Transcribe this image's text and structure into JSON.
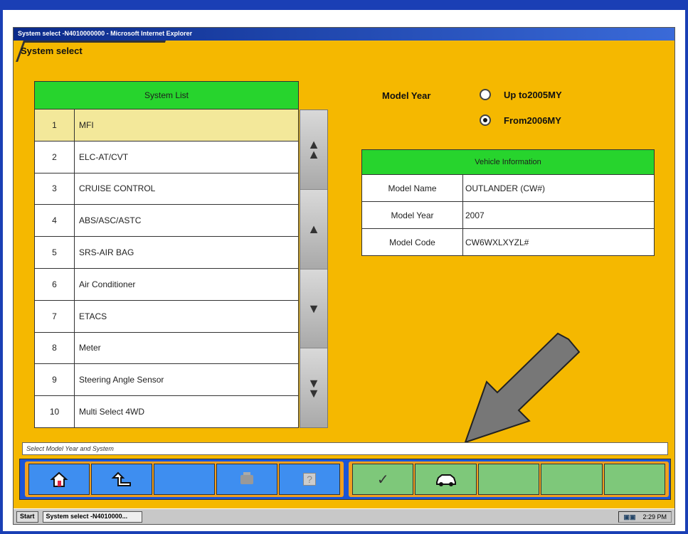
{
  "window": {
    "title": "System select -N4010000000 - Microsoft Internet Explorer",
    "header": "System select"
  },
  "system_list": {
    "heading": "System List",
    "rows": [
      {
        "num": "1",
        "name": "MFI"
      },
      {
        "num": "2",
        "name": "ELC-AT/CVT"
      },
      {
        "num": "3",
        "name": "CRUISE CONTROL"
      },
      {
        "num": "4",
        "name": "ABS/ASC/ASTC"
      },
      {
        "num": "5",
        "name": "SRS-AIR BAG"
      },
      {
        "num": "6",
        "name": "Air Conditioner"
      },
      {
        "num": "7",
        "name": "ETACS"
      },
      {
        "num": "8",
        "name": "Meter"
      },
      {
        "num": "9",
        "name": "Steering Angle Sensor"
      },
      {
        "num": "10",
        "name": "Multi Select 4WD"
      }
    ],
    "selected_index": 0
  },
  "scroll": {
    "page_up": "▲",
    "line_up": "▲",
    "line_down": "▼",
    "page_down": "▼"
  },
  "model_year": {
    "label": "Model Year",
    "option1": "Up to2005MY",
    "option2": "From2006MY",
    "selected": "option2"
  },
  "vehicle_info": {
    "heading": "Vehicle Information",
    "rows": [
      {
        "key": "Model Name",
        "value": "OUTLANDER (CW#)"
      },
      {
        "key": "Model Year",
        "value": "2007"
      },
      {
        "key": "Model Code",
        "value": "CW6WXLXYZL#"
      }
    ]
  },
  "status_text": "Select Model Year and System",
  "toolbar": {
    "icons": [
      "home-icon",
      "back-arrow-icon",
      "",
      "engine-icon",
      "help-icon",
      "check-icon",
      "car-icon",
      "",
      "",
      ""
    ],
    "check": "✓",
    "help": "?"
  },
  "taskbar": {
    "start": "Start",
    "task": "System select -N4010000...",
    "clock": "2:29 PM"
  },
  "colors": {
    "background": "#f5b800",
    "header_green": "#27d42d",
    "selected_row": "#f3e89a",
    "toolbar_blue": "#1a55d8",
    "toolbar_orange": "#f0a020"
  }
}
